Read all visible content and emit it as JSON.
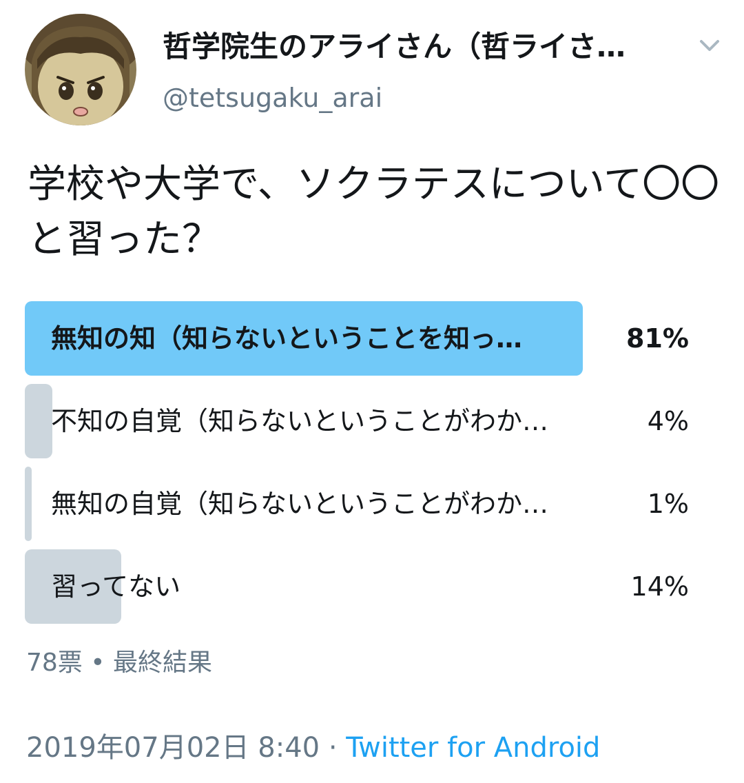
{
  "author": {
    "display_name": "哲学院生のアライさん（哲ライさ…",
    "handle": "@tetsugaku_arai",
    "avatar": "anime-girl-avatar"
  },
  "tweet": {
    "text": "学校や大学で、ソクラテスについて〇〇と習った？"
  },
  "poll": {
    "options": [
      {
        "label": "無知の知（知らないということを知っ…",
        "percent_text": "81%",
        "percent": 81,
        "winner": true
      },
      {
        "label": "不知の自覚（知らないということがわか…",
        "percent_text": "4%",
        "percent": 4,
        "winner": false
      },
      {
        "label": "無知の自覚（知らないということがわか…",
        "percent_text": "1%",
        "percent": 1,
        "winner": false
      },
      {
        "label": "習ってない",
        "percent_text": "14%",
        "percent": 14,
        "winner": false
      }
    ],
    "votes": "78票",
    "separator": "•",
    "status": "最終結果"
  },
  "meta": {
    "datetime": "2019年07月02日 8:40",
    "dot": "·",
    "source": "Twitter for Android"
  },
  "colors": {
    "winner_bar": "#71c9f8",
    "other_bar": "#ccd6dd",
    "secondary_text": "#657786",
    "link": "#1da1f2"
  },
  "icons": {
    "menu": "chevron-down-icon"
  }
}
